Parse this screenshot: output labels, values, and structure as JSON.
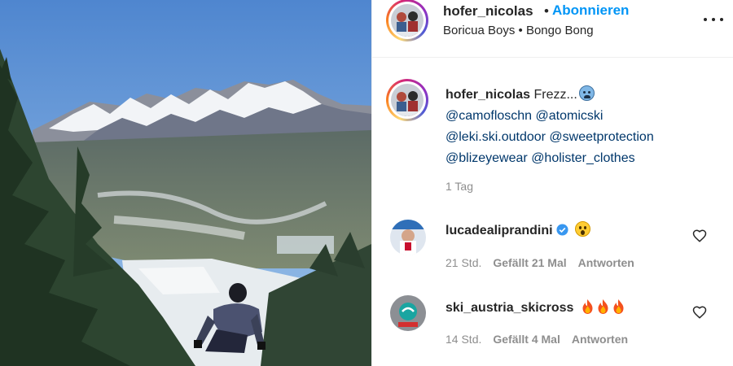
{
  "header": {
    "username": "hofer_nicolas",
    "separator": "•",
    "follow_label": "Abonnieren",
    "audio": "Boricua Boys • Bongo Bong"
  },
  "caption": {
    "username": "hofer_nicolas",
    "text": "Frezz...",
    "emoji": "cold-face-emoji",
    "mentions": [
      "@camofloschn",
      "@atomicski",
      "@leki.ski.outdoor",
      "@sweetprotection",
      "@blizeyewear",
      "@holister_clothes"
    ],
    "time_ago": "1 Tag"
  },
  "comments": [
    {
      "username": "lucadealiprandini",
      "verified": true,
      "text_emoji": "astonished-face-emoji",
      "time": "21 Std.",
      "likes": "Gefällt 21 Mal",
      "reply_label": "Antworten"
    },
    {
      "username": "ski_austria_skicross",
      "verified": false,
      "text_emoji": "fire-emoji fire-emoji fire-emoji",
      "time": "14 Std.",
      "likes": "Gefällt 4 Mal",
      "reply_label": "Antworten"
    }
  ],
  "icons": {
    "more": "more-options-icon",
    "like": "heart-icon",
    "verified": "verified-badge-icon"
  },
  "colors": {
    "link_blue": "#0095f6",
    "mention_blue": "#00376b",
    "muted_text": "#8e8e8e",
    "verified_blue": "#3897f0"
  }
}
